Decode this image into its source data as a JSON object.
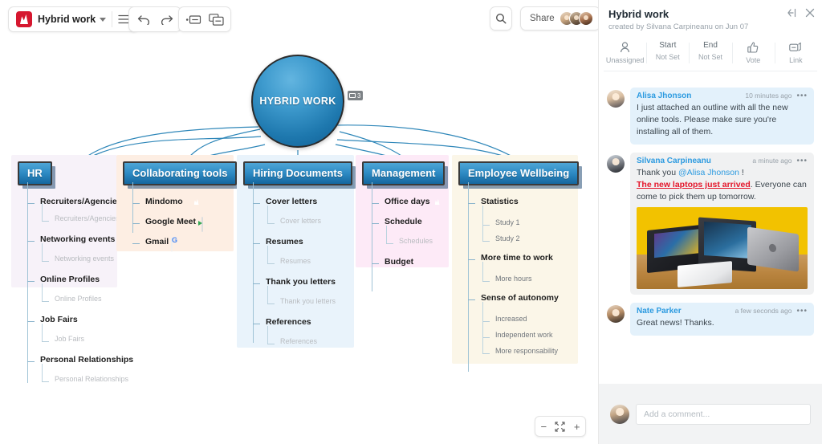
{
  "toolbar": {
    "logo_icon": "mindomo-logo-icon",
    "doc_title": "Hybrid work",
    "caret_icon": "chevron-down-icon",
    "menu_icon": "hamburger-menu-icon",
    "undo_icon": "undo-arrow-icon",
    "redo_icon": "redo-arrow-icon",
    "presentation_icon": "presentation-slide-icon",
    "duplicate_icon": "copy-slides-icon",
    "search_icon": "search-icon",
    "share_label": "Share",
    "share_avatars": [
      "avatar-1",
      "avatar-2",
      "avatar-3"
    ]
  },
  "zoom_controls": {
    "zoom_out_label": "−",
    "fit_icon": "fit-to-screen-icon",
    "zoom_in_label": "+"
  },
  "map": {
    "root": {
      "label": "HYBRID WORK",
      "comment_count": "3"
    },
    "branches": [
      {
        "id": "hr",
        "title": "HR",
        "panel_color": "#f7f2f9",
        "items": [
          {
            "label": "Recruiters/Agencies",
            "sub": "Recruiters/Agencies"
          },
          {
            "label": "Networking events",
            "sub": "Networking events"
          },
          {
            "label": "Online Profiles",
            "sub": "Online Profiles"
          },
          {
            "label": "Job Fairs",
            "sub": "Job Fairs"
          },
          {
            "label": "Personal Relationships",
            "sub": "Personal Relationships"
          }
        ]
      },
      {
        "id": "collaborating-tools",
        "title": "Collaborating tools",
        "panel_color": "#fdeee3",
        "items": [
          {
            "label": "Mindomo",
            "icon": "mindomo-app-icon"
          },
          {
            "label": "Google Meet",
            "icon": "google-meet-icon"
          },
          {
            "label": "Gmail",
            "icon": "gmail-icon"
          }
        ]
      },
      {
        "id": "hiring-documents",
        "title": "Hiring Documents",
        "panel_color": "#e9f3fb",
        "items": [
          {
            "label": "Cover letters",
            "sub": "Cover letters"
          },
          {
            "label": "Resumes",
            "sub": "Resumes"
          },
          {
            "label": "Thank you letters",
            "sub": "Thank you letters"
          },
          {
            "label": "References",
            "sub": "References"
          }
        ]
      },
      {
        "id": "management",
        "title": "Management",
        "panel_color": "#fdeaf7",
        "items": [
          {
            "label": "Office days",
            "icon": "mindomo-app-icon"
          },
          {
            "label": "Schedule",
            "sub": "Schedules"
          },
          {
            "label": "Budget"
          }
        ]
      },
      {
        "id": "employee-wellbeing",
        "title": "Employee Wellbeing",
        "panel_color": "#fbf6e8",
        "items": [
          {
            "label": "Statistics",
            "subs": [
              "Study 1",
              "Study 2"
            ]
          },
          {
            "label": "More time to work",
            "subs": [
              "More hours"
            ]
          },
          {
            "label": "Sense of autonomy",
            "subs": [
              "Increased",
              "Independent work",
              "More responsability"
            ]
          }
        ]
      }
    ]
  },
  "sidebar": {
    "title": "Hybrid work",
    "subtitle": "created by Silvana Carpineanu on Jun 07",
    "collapse_icon": "collapse-panel-icon",
    "close_icon": "close-icon",
    "properties": [
      {
        "icon": "person-icon",
        "top": "",
        "label": "Unassigned"
      },
      {
        "icon": "",
        "top": "Start",
        "label": "Not Set"
      },
      {
        "icon": "",
        "top": "End",
        "label": "Not Set"
      },
      {
        "icon": "thumbs-up-icon",
        "top": "",
        "label": "Vote"
      },
      {
        "icon": "link-icon",
        "top": "",
        "label": "Link"
      }
    ],
    "comments": [
      {
        "author": "Alisa Jhonson",
        "time": "10 minutes ago",
        "avatar": "av-alisa",
        "bubble": "b-blue",
        "body": "I just attached an outline with all the new online tools. Please make sure you're installing all of them.",
        "more_icon": "more-options-icon"
      },
      {
        "author": "Silvana Carpineanu",
        "time": "a minute ago",
        "avatar": "av-silvana",
        "bubble": "b-gray",
        "body_part1": "Thank you ",
        "mention": "@Alisa Jhonson",
        "body_part2": " !",
        "highlight": "The new laptops just arrived",
        "body_part3": ". Everyone can come to pick them up tomorrow.",
        "image_alt": "three-laptops-on-desk-photo",
        "more_icon": "more-options-icon"
      },
      {
        "author": "Nate Parker",
        "time": "a few seconds ago",
        "avatar": "av-nate",
        "bubble": "b-blue",
        "body": "Great news! Thanks.",
        "more_icon": "more-options-icon"
      }
    ],
    "compose": {
      "avatar": "av-me",
      "placeholder": "Add a comment..."
    }
  },
  "colors": {
    "brand_red": "#d6172f",
    "node_blue": "#2e8bc4",
    "link_blue": "#2b9ae0",
    "highlight_red": "#e4162b"
  }
}
